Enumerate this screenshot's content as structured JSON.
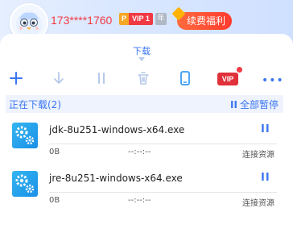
{
  "user": {
    "phone": "173****1760",
    "vip_prefix": "P",
    "vip_label": "VIP 1",
    "year_label": "年",
    "renew_label": "续费福利"
  },
  "tab": {
    "download_label": "下载"
  },
  "toolbar": {
    "icons": [
      "add-icon",
      "download-arrow-icon",
      "pause-icon",
      "trash-icon",
      "phone-icon",
      "vip-icon",
      "more-icon"
    ],
    "vip_label": "VIP",
    "more_label": "•••"
  },
  "section": {
    "title": "正在下载(2)",
    "pause_all_label": "全部暂停",
    "pause_all_icon": "II"
  },
  "downloads": [
    {
      "name": "jdk-8u251-windows-x64.exe",
      "size": "0B",
      "time": "--:--:--",
      "status": "连接资源",
      "progress": 0
    },
    {
      "name": "jre-8u251-windows-x64.exe",
      "size": "0B",
      "time": "--:--:--",
      "status": "连接资源",
      "progress": 0
    }
  ],
  "colors": {
    "accent": "#3a76f0",
    "phone_red": "#f03a43",
    "vip_orange": "#f5a623",
    "renew_red": "#ff3b2f",
    "file_icon_blue": "#1b8fe8"
  }
}
